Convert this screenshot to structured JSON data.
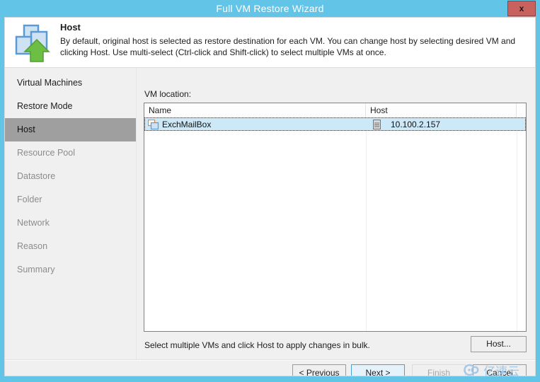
{
  "window": {
    "title": "Full VM Restore Wizard",
    "close_label": "x",
    "titlebar_color": "#62c5e8",
    "close_button_color": "#c7625f"
  },
  "banner": {
    "icon": "vm-restore-upload-icon",
    "title": "Host",
    "description": "By default, original host is selected as restore destination for each VM. You can change host by selecting desired VM and clicking Host. Use multi-select (Ctrl-click and Shift-click) to select multiple VMs at once."
  },
  "sidebar": {
    "items": [
      {
        "label": "Virtual Machines",
        "state": "done"
      },
      {
        "label": "Restore Mode",
        "state": "done"
      },
      {
        "label": "Host",
        "state": "active"
      },
      {
        "label": "Resource Pool",
        "state": "pending"
      },
      {
        "label": "Datastore",
        "state": "pending"
      },
      {
        "label": "Folder",
        "state": "pending"
      },
      {
        "label": "Network",
        "state": "pending"
      },
      {
        "label": "Reason",
        "state": "pending"
      },
      {
        "label": "Summary",
        "state": "pending"
      }
    ],
    "active_highlight_color": "#9f9f9f"
  },
  "content": {
    "vm_location_label": "VM location:",
    "table": {
      "columns": [
        "Name",
        "Host"
      ],
      "rows": [
        {
          "name": "ExchMailBox",
          "name_icon": "virtual-machine-icon",
          "host": "10.100.2.157",
          "host_icon": "server-host-icon",
          "selected": true
        }
      ],
      "selection_color": "#cde8f7"
    },
    "bulk_hint": "Select multiple VMs and click Host to apply changes in bulk.",
    "host_button_label": "Host..."
  },
  "footer": {
    "buttons": [
      {
        "label": "< Previous",
        "state": "enabled"
      },
      {
        "label": "Next >",
        "state": "focused"
      },
      {
        "label": "Finish",
        "state": "disabled"
      },
      {
        "label": "Cancel",
        "state": "enabled"
      }
    ]
  },
  "watermark": {
    "text": "亿速云",
    "icon": "cloud-logo-icon",
    "color": "#9fc6e8"
  }
}
